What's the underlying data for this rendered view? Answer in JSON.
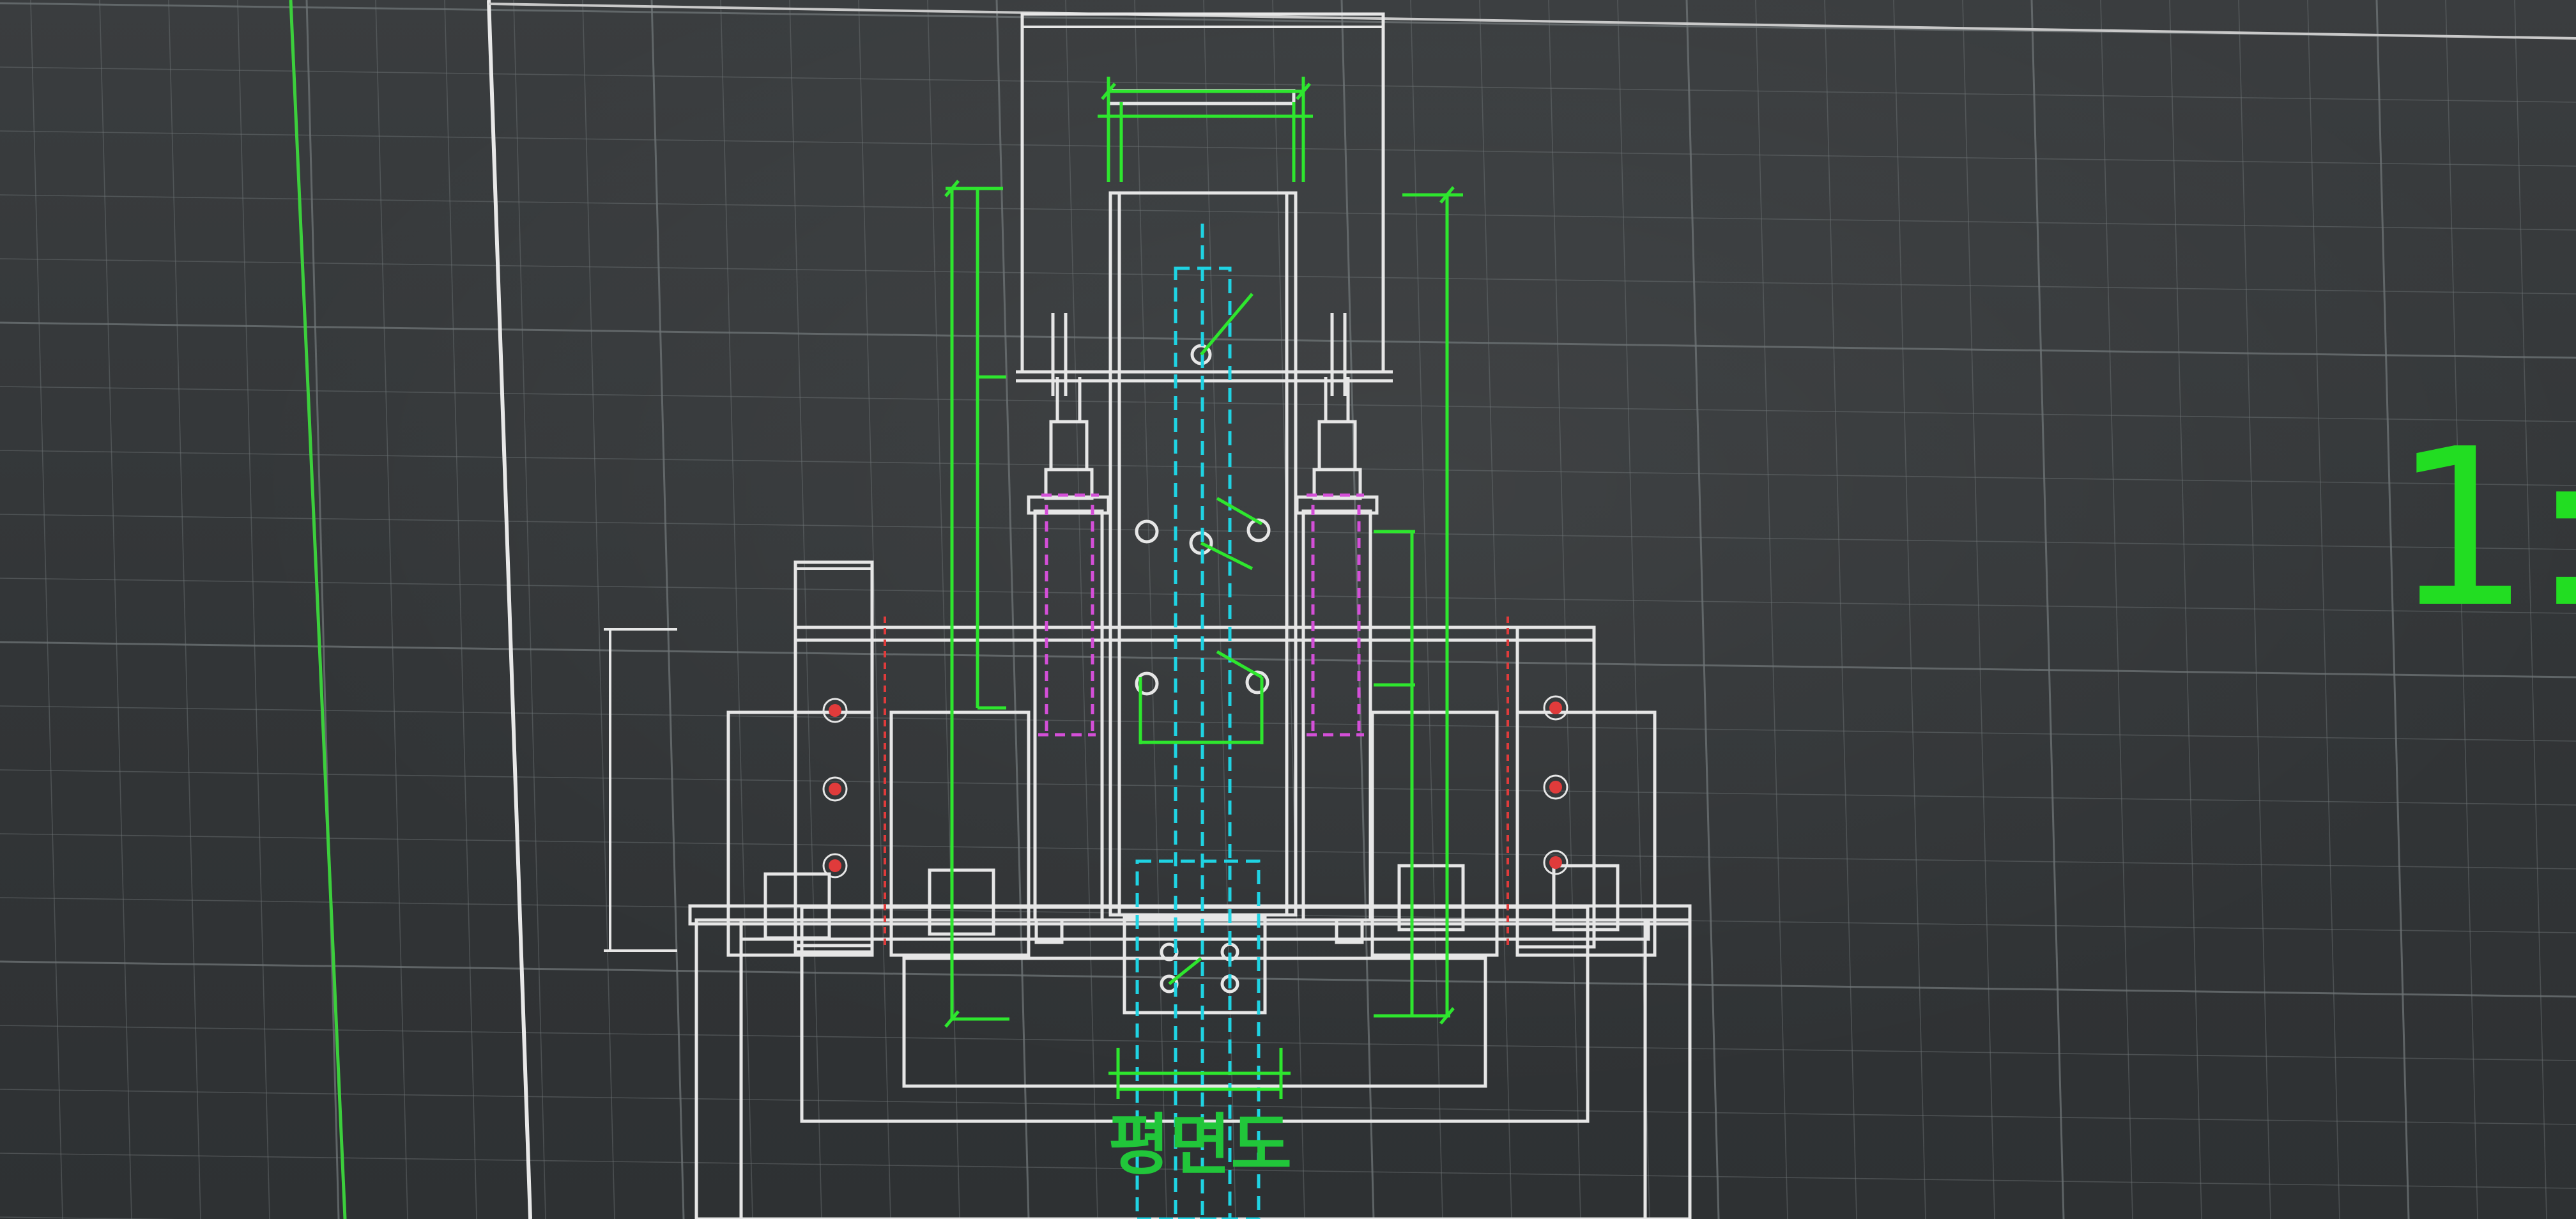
{
  "drawing": {
    "title_text": "평면도",
    "scale_label_fragment": "1:"
  },
  "colors": {
    "background": "#343739",
    "grid": "#6f7577",
    "outline": "#e6e6e6",
    "dimension": "#2ee62e",
    "center_line": "#1fd3e3",
    "hidden_line": "#d44fd8",
    "hole_marker": "#e03b3b"
  }
}
